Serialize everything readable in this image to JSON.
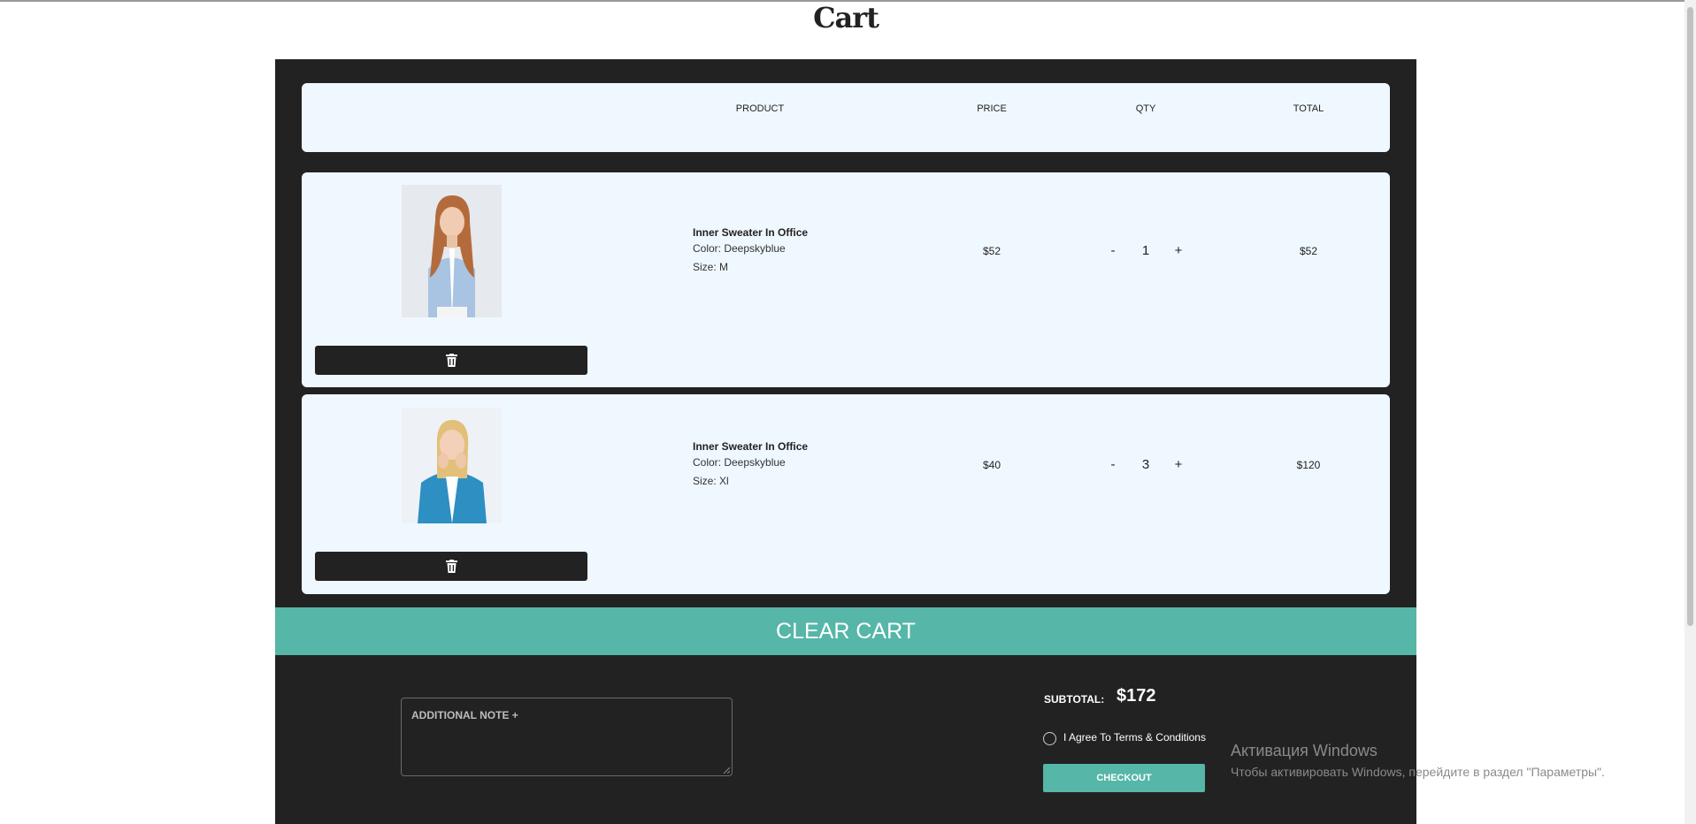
{
  "page": {
    "title": "Cart"
  },
  "columns": {
    "product": "PRODUCT",
    "price": "PRICE",
    "qty": "QTY",
    "total": "TOTAL"
  },
  "items": [
    {
      "name": "Inner Sweater In Office",
      "color": "Color: Deepskyblue",
      "size": "Size: M",
      "price": "$52",
      "qty": "1",
      "total": "$52",
      "image_icon": "woman-blue-shirt-photo"
    },
    {
      "name": "Inner Sweater In Office",
      "color": "Color: Deepskyblue",
      "size": "Size: Xl",
      "price": "$40",
      "qty": "3",
      "total": "$120",
      "image_icon": "woman-denim-shirt-photo"
    }
  ],
  "controls": {
    "minus": "-",
    "plus": "+",
    "delete_icon": "trash-icon"
  },
  "clear_cart_label": "CLEAR CART",
  "note": {
    "placeholder": "ADDITIONAL NOTE +"
  },
  "summary": {
    "subtotal_label": "SUBTOTAL:",
    "subtotal_value": "$172",
    "agree_label": "I Agree To Terms & Conditions",
    "checkout_label": "CHECKOUT"
  },
  "watermark": {
    "title": "Активация Windows",
    "subtitle": "Чтобы активировать Windows, перейдите в раздел \"Параметры\"."
  },
  "colors": {
    "panel": "#222222",
    "card": "#f0f8ff",
    "accent": "#56b6a7"
  }
}
